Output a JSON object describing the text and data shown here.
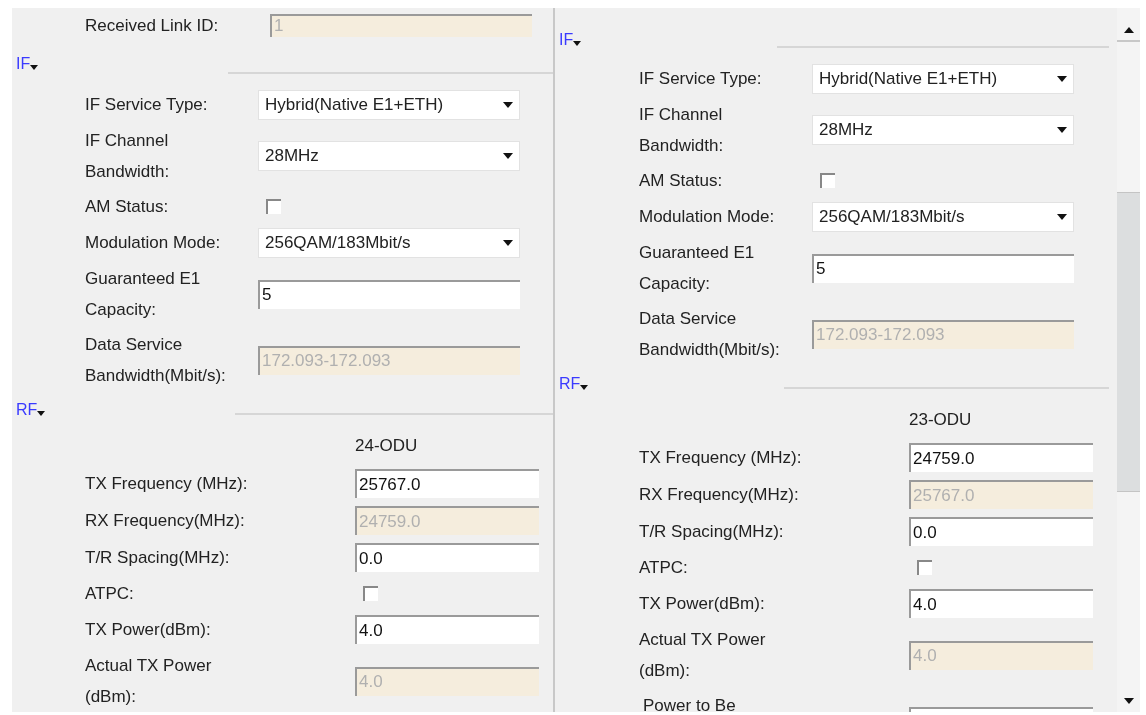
{
  "panels": [
    {
      "items": [
        {
          "kind": "field",
          "label": "Received Link ID:",
          "value": "1",
          "disabled": true
        },
        {
          "kind": "header",
          "title": "IF"
        },
        {
          "kind": "select",
          "label": "IF Service Type:",
          "value": "Hybrid(Native E1+ETH)"
        },
        {
          "kind": "select",
          "label": "IF Channel\nBandwidth:",
          "value": "28MHz"
        },
        {
          "kind": "checkbox",
          "label": "AM Status:",
          "checked": false
        },
        {
          "kind": "select",
          "label": "Modulation Mode:",
          "value": "256QAM/183Mbit/s"
        },
        {
          "kind": "field",
          "label": "Guaranteed E1\nCapacity:",
          "value": "5",
          "disabled": false
        },
        {
          "kind": "field",
          "label": "Data Service\nBandwidth(Mbit/s):",
          "value": "172.093-172.093",
          "disabled": true
        },
        {
          "kind": "header",
          "title": "RF"
        },
        {
          "kind": "caption",
          "text": "24-ODU"
        },
        {
          "kind": "field",
          "label": "TX Frequency (MHz):",
          "value": "25767.0",
          "disabled": false
        },
        {
          "kind": "field",
          "label": "RX Frequency(MHz):",
          "value": "24759.0",
          "disabled": true
        },
        {
          "kind": "field",
          "label": "T/R Spacing(MHz):",
          "value": "0.0",
          "disabled": false
        },
        {
          "kind": "checkbox",
          "label": "ATPC:",
          "checked": false
        },
        {
          "kind": "field",
          "label": "TX Power(dBm):",
          "value": "4.0",
          "disabled": false
        },
        {
          "kind": "field",
          "label": "Actual TX Power\n(dBm):",
          "value": "4.0",
          "disabled": true
        }
      ]
    },
    {
      "items": [
        {
          "kind": "header",
          "title": "IF"
        },
        {
          "kind": "select",
          "label": "IF Service Type:",
          "value": "Hybrid(Native E1+ETH)"
        },
        {
          "kind": "select",
          "label": "IF Channel\nBandwidth:",
          "value": "28MHz"
        },
        {
          "kind": "checkbox",
          "label": "AM Status:",
          "checked": false
        },
        {
          "kind": "select",
          "label": "Modulation Mode:",
          "value": "256QAM/183Mbit/s"
        },
        {
          "kind": "field",
          "label": "Guaranteed E1\nCapacity:",
          "value": "5",
          "disabled": false
        },
        {
          "kind": "field",
          "label": "Data Service\nBandwidth(Mbit/s):",
          "value": "172.093-172.093",
          "disabled": true
        },
        {
          "kind": "header",
          "title": "RF"
        },
        {
          "kind": "caption",
          "text": "23-ODU"
        },
        {
          "kind": "field",
          "label": "TX Frequency (MHz):",
          "value": "24759.0",
          "disabled": false
        },
        {
          "kind": "field",
          "label": "RX Frequency(MHz):",
          "value": "25767.0",
          "disabled": true
        },
        {
          "kind": "field",
          "label": "T/R Spacing(MHz):",
          "value": "0.0",
          "disabled": false
        },
        {
          "kind": "checkbox",
          "label": "ATPC:",
          "checked": false
        },
        {
          "kind": "field",
          "label": "TX Power(dBm):",
          "value": "4.0",
          "disabled": false
        },
        {
          "kind": "field",
          "label": "Actual TX Power\n(dBm):",
          "value": "4.0",
          "disabled": true
        },
        {
          "kind": "cutoff",
          "label": "Power to Be"
        }
      ]
    }
  ]
}
